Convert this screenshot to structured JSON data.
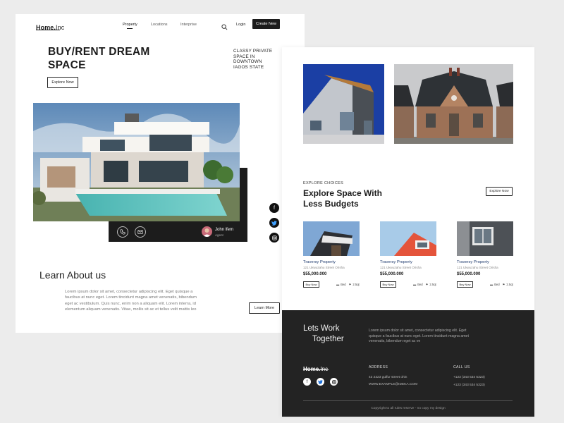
{
  "left_page": {
    "logo": {
      "bold": "Home.",
      "thin": "Inc"
    },
    "nav": [
      "Property",
      "Locations",
      "Interprise"
    ],
    "login_label": "Login",
    "create_label": "Create New",
    "hero_title_line1": "BUY/RENT DREAM",
    "hero_title_line2": "SPACE",
    "hero_side_lines": [
      "CLASSY PRIVATE",
      "SPACE IN",
      "DOWNTOWN",
      "IAGOS STATE"
    ],
    "explore_label": "Explore Now",
    "agent_name": "John lfem",
    "agent_role": "Agent",
    "learn_title": "Learn About us",
    "learn_lines": [
      "Lorem ipsum dolor sit amet, consectetur adipiscing elit. Eget quisque a",
      "faucibus at nunc eget. Lorem tincidunt magna amet venenatis, bibendum",
      "eget ac vestibulum. Quis nunc, enim non a aliquam elit. Lorem interra, id",
      "elementum aliquam venenatis. Vitae, mollis sit ac et tellus velit mattis leo"
    ],
    "learn_more_label": "Learn More"
  },
  "right_page": {
    "eyebrow": "EXPLORE CHOICES",
    "title_line1": "Explore Space With",
    "title_line2": "Less Budgets",
    "explore_label": "Explore Now",
    "cards": [
      {
        "title": "Traversy Property",
        "address": "121 Ukwuzahu Street Orisha",
        "price": "$55,000.000",
        "buy": "Buy Now",
        "beds": "Bed",
        "area": "2.5qt",
        "color": "#8fb0d6"
      },
      {
        "title": "Traversy Property",
        "address": "121 Ukwuzahu Street Orisha",
        "price": "$55,000.000",
        "buy": "Buy Now",
        "beds": "Bed",
        "area": "2.5qt",
        "color": "#e2583f"
      },
      {
        "title": "Traversy Property",
        "address": "121 Ukwuzahu Street Orisha",
        "price": "$55,000.000",
        "buy": "Buy Now",
        "beds": "Bed",
        "area": "2.5qt",
        "color": "#5a5e63"
      }
    ],
    "footer": {
      "heading_line1": "Lets Work",
      "heading_line2": "Together",
      "desc_lines": [
        "Lorem ipsum dolor sit amet, consectetur adipiscing elit. Eget",
        "quisque a faucibus at nunc eget. Lorem tincidunt magna amet",
        "venenatis, bibendum eget ac ve"
      ],
      "logo": {
        "bold": "Home.",
        "thin": "Inc"
      },
      "address_label": "ADDRESS",
      "address_lines": [
        "43 2323 gulfur street ohin",
        "WWW.EXAMPLE@IDEKA.COM"
      ],
      "call_label": "CALL US",
      "phone_lines": [
        "+123 (343 534 5323)",
        "+123 (343 534 5323)"
      ],
      "copyright": "Copyright to all rules reserve - no copy my design"
    }
  },
  "icons": {
    "search": "search-icon",
    "facebook": "facebook-icon",
    "twitter": "twitter-icon",
    "instagram": "instagram-icon",
    "phone": "phone-icon",
    "mail": "mail-icon"
  },
  "colors": {
    "dark": "#1c1c1c",
    "footer_bg": "#232323",
    "link_blue": "#1e3a6e",
    "twitter": "#1d6fd8"
  }
}
